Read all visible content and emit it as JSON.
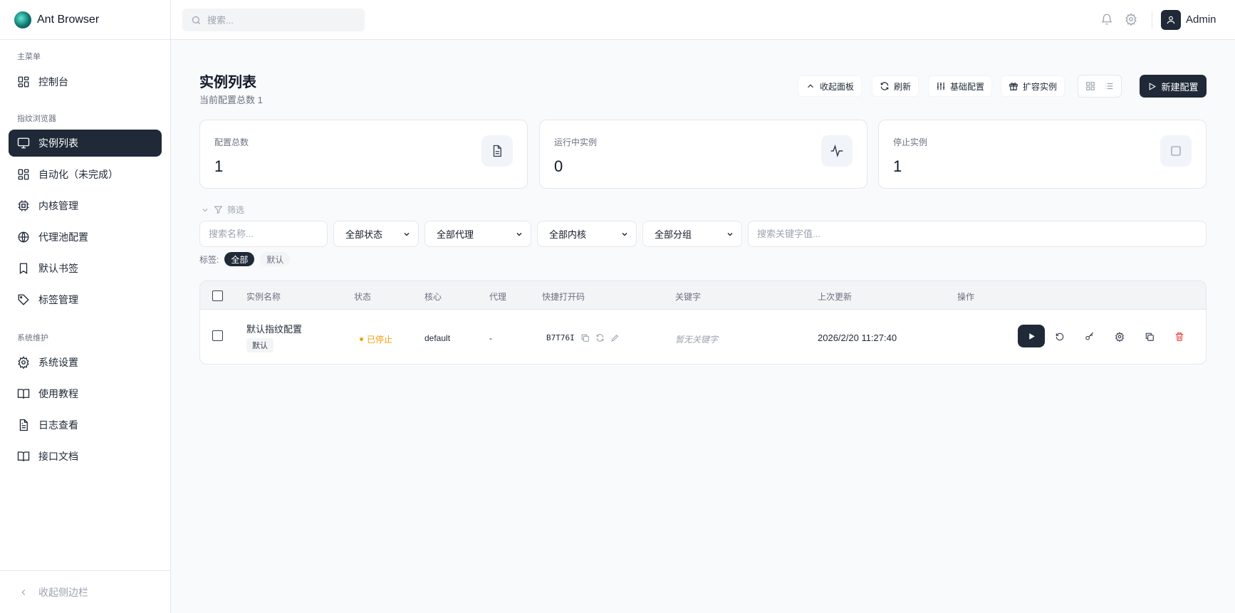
{
  "app": {
    "brand": "Ant Browser"
  },
  "sidebar": {
    "section_main": "主菜单",
    "section_fingerprint": "指纹浏览器",
    "section_system": "系统维护",
    "items": [
      {
        "label": "控制台",
        "icon": "dashboard-icon"
      },
      {
        "label": "实例列表",
        "icon": "monitor-icon",
        "active": true
      },
      {
        "label": "自动化（未完成）",
        "icon": "dashboard-icon"
      },
      {
        "label": "内核管理",
        "icon": "cpu-icon"
      },
      {
        "label": "代理池配置",
        "icon": "globe-icon"
      },
      {
        "label": "默认书签",
        "icon": "bookmark-icon"
      },
      {
        "label": "标签管理",
        "icon": "tag-icon"
      },
      {
        "label": "系统设置",
        "icon": "gear-icon"
      },
      {
        "label": "使用教程",
        "icon": "book-icon"
      },
      {
        "label": "日志查看",
        "icon": "document-icon"
      },
      {
        "label": "接口文档",
        "icon": "book-icon"
      }
    ],
    "collapse_label": "收起侧边栏"
  },
  "topbar": {
    "search_placeholder": "搜索...",
    "username": "Admin"
  },
  "page": {
    "title": "实例列表",
    "subtitle": "当前配置总数 1",
    "actions": {
      "collapse_panel": "收起面板",
      "refresh": "刷新",
      "base_config": "基础配置",
      "expand_instance": "扩容实例",
      "new_config": "新建配置"
    }
  },
  "stats": [
    {
      "label": "配置总数",
      "value": "1",
      "icon": "document-icon"
    },
    {
      "label": "运行中实例",
      "value": "0",
      "icon": "activity-icon"
    },
    {
      "label": "停止实例",
      "value": "1",
      "icon": "square-icon"
    }
  ],
  "filters": {
    "toggle_label": "筛选",
    "name_placeholder": "搜索名称...",
    "status": "全部状态",
    "proxy": "全部代理",
    "core": "全部内核",
    "group": "全部分组",
    "keyword_placeholder": "搜索关键字值...",
    "tags_label": "标签:",
    "tags": [
      "全部",
      "默认"
    ]
  },
  "table": {
    "headers": [
      "实例名称",
      "状态",
      "核心",
      "代理",
      "快捷打开码",
      "关键字",
      "上次更新",
      "操作"
    ],
    "rows": [
      {
        "name": "默认指纹配置",
        "tag": "默认",
        "status": "已停止",
        "core": "default",
        "proxy": "-",
        "code": "B7T76I",
        "keyword": "暂无关键字",
        "updated": "2026/2/20 11:27:40"
      }
    ]
  },
  "colors": {
    "primary": "#1f2937",
    "status_stopped": "#f59e0b",
    "danger": "#ef4444"
  }
}
